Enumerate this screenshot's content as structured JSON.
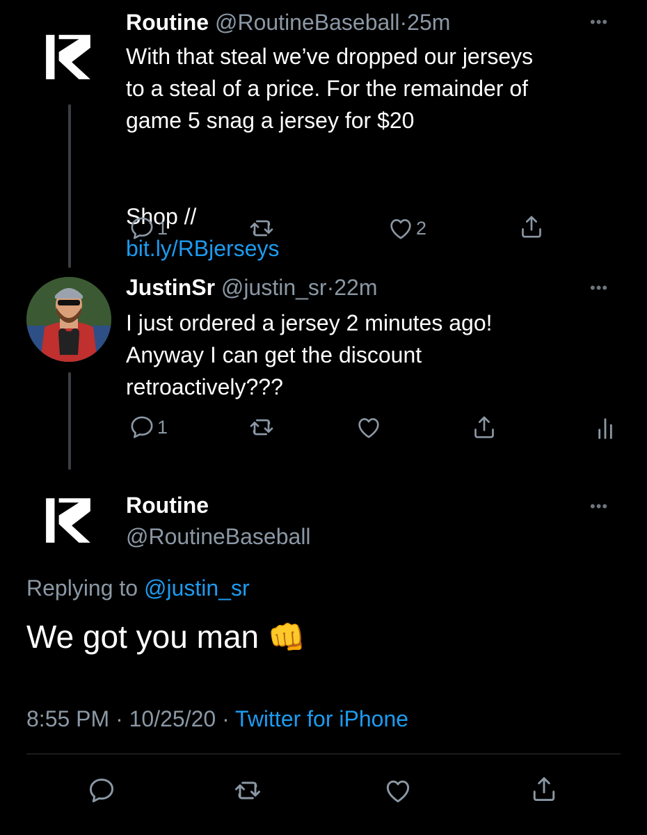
{
  "tweet1": {
    "name": "Routine",
    "handle": "@RoutineBaseball",
    "time": "25m",
    "text": "With that steal we’ve dropped our jerseys\nto a steal of a price. For the remainder of\ngame 5 snag a jersey for $20",
    "shop_prefix": "Shop //",
    "link": "bit.ly/RBjerseys",
    "reply_count": "1",
    "like_count": "2"
  },
  "tweet2": {
    "name": "JustinSr",
    "handle": "@justin_sr",
    "time": "22m",
    "text": "I just ordered a jersey 2 minutes ago!\nAnyway I can get the discount\nretroactively???",
    "reply_count": "1"
  },
  "main": {
    "name": "Routine",
    "handle": "@RoutineBaseball",
    "replying_prefix": "Replying to",
    "replying_handle": "@justin_sr",
    "text": "We got you man",
    "emoji": "👊",
    "time": "8:55 PM",
    "date": "10/25/20",
    "source": "Twitter for iPhone"
  },
  "separator": "·",
  "more_glyph": "•••",
  "icons": [
    "reply-icon",
    "retweet-icon",
    "like-icon",
    "share-icon",
    "analytics-icon",
    "more-icon"
  ],
  "colors": {
    "background": "#000000",
    "link": "#1d9bf0",
    "muted": "#8b98a5",
    "thread_line": "#3a3f44"
  }
}
